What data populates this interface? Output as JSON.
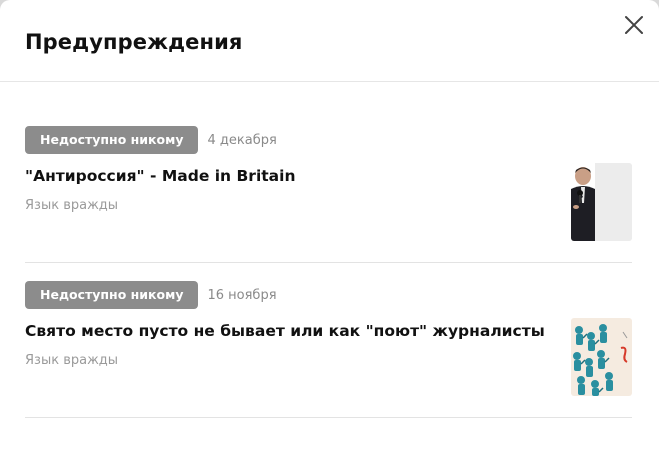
{
  "dialog": {
    "title": "Предупреждения",
    "close_icon": "close-icon"
  },
  "warnings": [
    {
      "badge": "Недоступно никому",
      "date": "4 декабря",
      "title": "\"Антироссия\" - Made in Britain",
      "reason": "Язык вражды",
      "thumbnail": "man-with-microphone-thumbnail"
    },
    {
      "badge": "Недоступно никому",
      "date": "16 ноября",
      "title": "Свято место пусто не бывает или как \"поют\" журналисты",
      "reason": "Язык вражды",
      "thumbnail": "crowd-illustration-thumbnail"
    }
  ],
  "colors": {
    "badge_bg": "#8c8c8c",
    "title_text": "#111111",
    "muted_text": "#9a9a9a",
    "divider": "#e3e3e3"
  }
}
